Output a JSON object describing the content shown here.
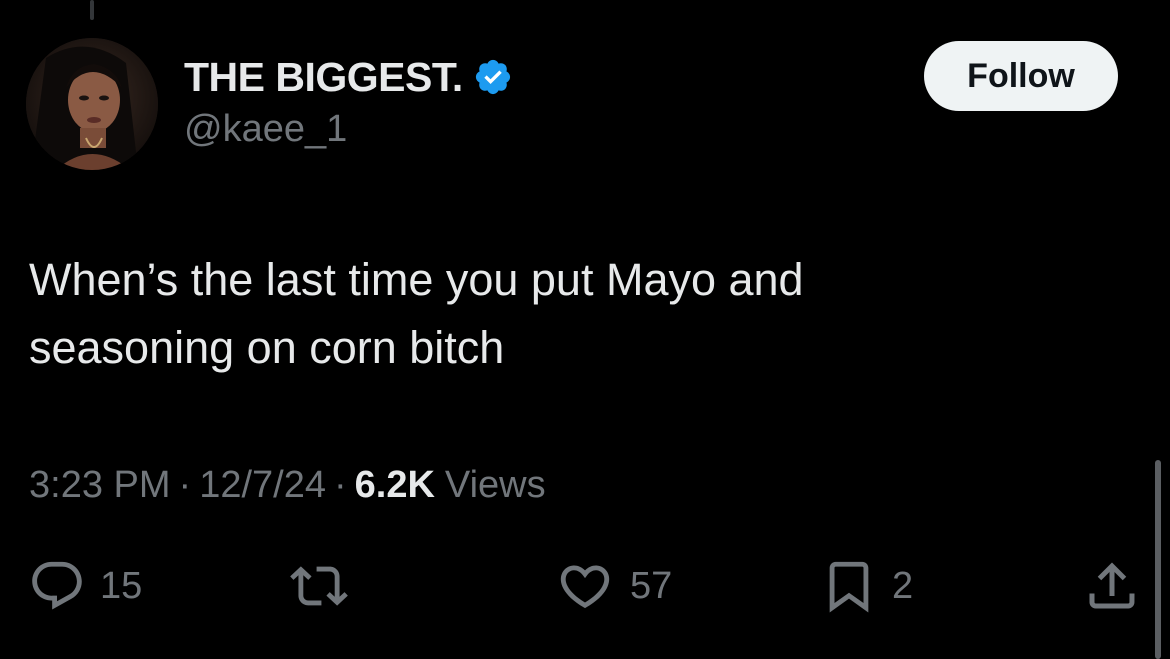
{
  "tweet": {
    "author": {
      "display_name": "THE BIGGEST.",
      "handle": "@kaee_1",
      "verified": true
    },
    "follow_label": "Follow",
    "text": "When’s the last time you put Mayo and\nseasoning on corn bitch",
    "meta": {
      "time": "3:23 PM",
      "separator": "·",
      "date": "12/7/24",
      "views_count": "6.2K",
      "views_label": "Views"
    },
    "actions": {
      "replies": "15",
      "reposts": "",
      "likes": "57",
      "bookmarks": "2"
    }
  },
  "colors": {
    "background": "#000000",
    "primary_text": "#e7e9ea",
    "secondary_text": "#71767b",
    "verified_blue": "#1d9bf0",
    "follow_button_bg": "#eff3f4"
  },
  "icons": {
    "verified": "verified-badge-icon",
    "reply": "reply-icon",
    "repost": "repost-icon",
    "like": "heart-icon",
    "bookmark": "bookmark-icon",
    "share": "share-icon"
  }
}
